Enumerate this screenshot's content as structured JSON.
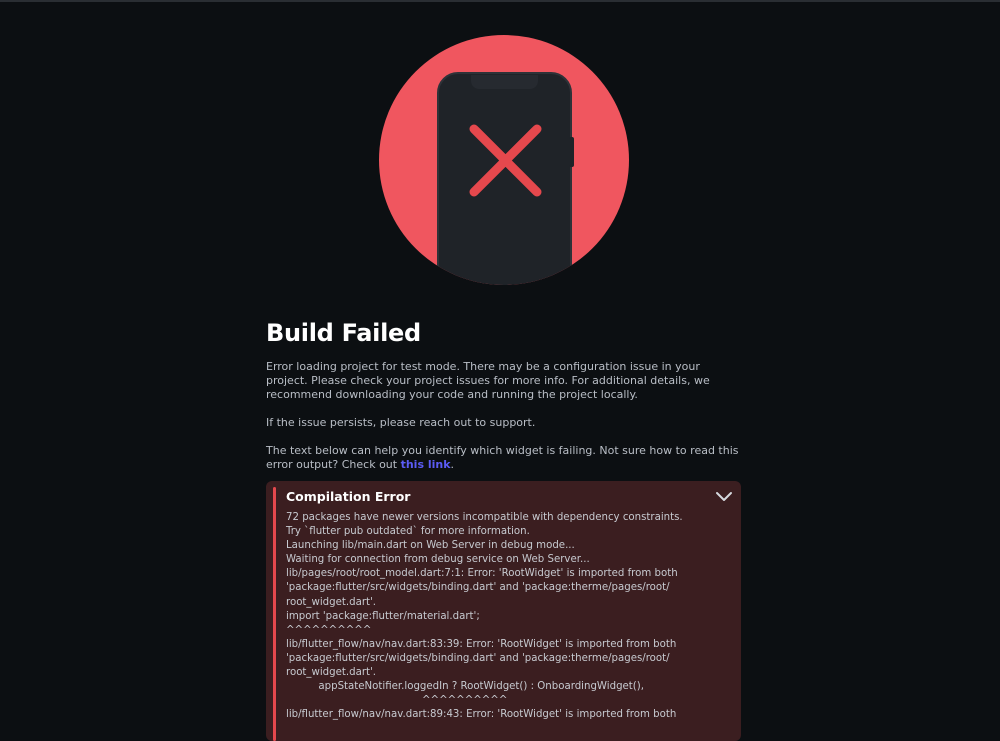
{
  "page": {
    "title": "Build Failed",
    "paragraph_1": "Error loading project for test mode. There may be a configuration issue in your project. Please check your project issues for more info. For additional details, we recommend downloading your code and running the project locally.",
    "paragraph_2": "If the issue persists, please reach out to support.",
    "paragraph_3_text": "The text below can help you identify which widget is failing. Not sure how to read this error output? Check out ",
    "paragraph_3_link": "this link",
    "paragraph_3_end": "."
  },
  "illustration": {
    "icon": "phone-error-icon",
    "circle_color": "#f0565f",
    "phone_color": "#1f2328",
    "x_color": "#e5484d"
  },
  "error_panel": {
    "title": "Compilation Error",
    "expand_icon": "chevron-down-icon",
    "log_lines": [
      "72 packages have newer versions incompatible with dependency constraints.",
      "Try `flutter pub outdated` for more information.",
      "Launching lib/main.dart on Web Server in debug mode...",
      "Waiting for connection from debug service on Web Server...",
      "lib/pages/root/root_model.dart:7:1: Error: 'RootWidget' is imported from both",
      "'package:flutter/src/widgets/binding.dart' and 'package:therme/pages/root/",
      "root_widget.dart'.",
      "import 'package:flutter/material.dart';",
      "^^^^^^^^^^",
      "lib/flutter_flow/nav/nav.dart:83:39: Error: 'RootWidget' is imported from both",
      "'package:flutter/src/widgets/binding.dart' and 'package:therme/pages/root/",
      "root_widget.dart'.",
      "          appStateNotifier.loggedIn ? RootWidget() : OnboardingWidget(),",
      "                                          ^^^^^^^^^^",
      "lib/flutter_flow/nav/nav.dart:89:43: Error: 'RootWidget' is imported from both"
    ],
    "accent_color": "#e5484d",
    "background_color": "#3b1e20"
  }
}
